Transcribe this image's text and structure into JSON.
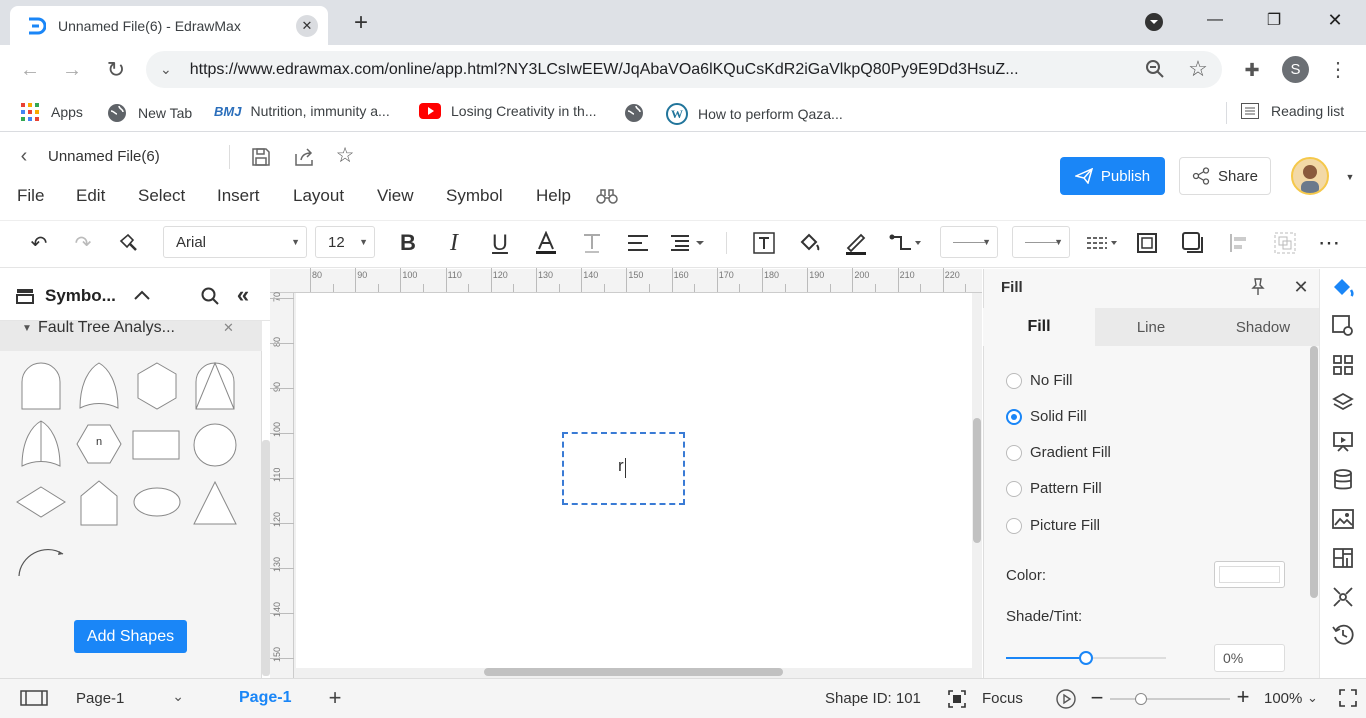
{
  "browser": {
    "tab_title": "Unnamed File(6) - EdrawMax",
    "url": "https://www.edrawmax.com/online/app.html?NY3LCsIwEEW/JqAbaVOa6lKQuCsKdR2iGaVlkpQ80Py9E9Dd3HsuZ...",
    "avatar_letter": "S",
    "bookmarks": [
      "Apps",
      "New Tab",
      "Nutrition, immunity a...",
      "Losing Creativity in th...",
      "How to perform Qaza..."
    ],
    "reading_list": "Reading list"
  },
  "app": {
    "file_name": "Unnamed File(6)",
    "menu": [
      "File",
      "Edit",
      "Select",
      "Insert",
      "Layout",
      "View",
      "Symbol",
      "Help"
    ],
    "publish_label": "Publish",
    "share_label": "Share",
    "font_name": "Arial",
    "font_size": "12"
  },
  "left_panel": {
    "title": "Symbo...",
    "library": "Fault Tree Analys...",
    "hex_label": "n",
    "add_shapes_label": "Add Shapes"
  },
  "ruler": {
    "top": [
      "80",
      "90",
      "100",
      "110",
      "120",
      "130",
      "140",
      "150",
      "160",
      "170",
      "180",
      "190",
      "200",
      "210",
      "220"
    ],
    "left": [
      "70",
      "80",
      "90",
      "100",
      "110",
      "120",
      "130",
      "140",
      "150"
    ]
  },
  "canvas": {
    "text_in_shape": "r"
  },
  "right_panel": {
    "title": "Fill",
    "tabs": [
      "Fill",
      "Line",
      "Shadow"
    ],
    "options": [
      "No Fill",
      "Solid Fill",
      "Gradient Fill",
      "Pattern Fill",
      "Picture Fill"
    ],
    "color_label": "Color:",
    "shade_label": "Shade/Tint:",
    "shade_value": "0%",
    "shade_slider_fraction": 0.5
  },
  "status": {
    "page_select": "Page-1",
    "page_tab": "Page-1",
    "shape_id": "Shape ID: 101",
    "focus": "Focus",
    "zoom": "100%"
  },
  "colors": {
    "accent": "#1a86f7",
    "selection": "#3a7bd5"
  }
}
